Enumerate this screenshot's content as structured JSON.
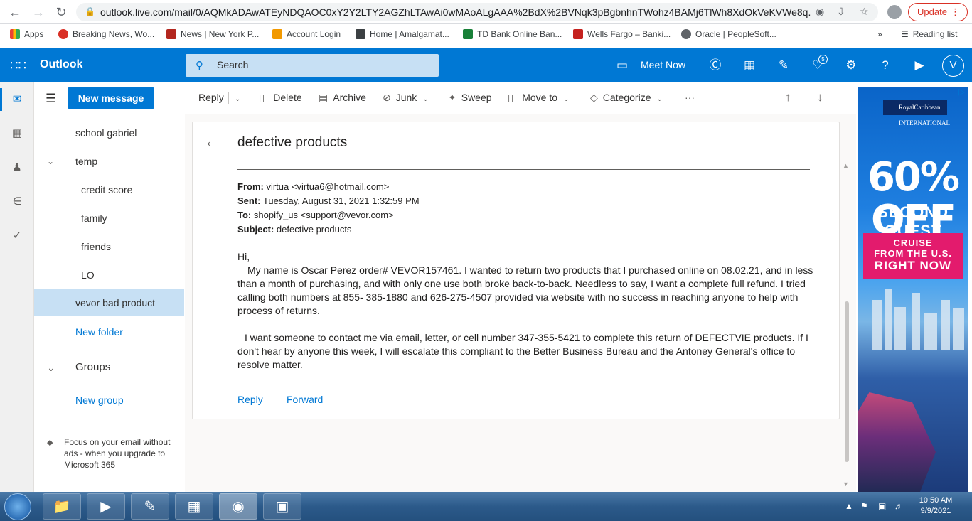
{
  "browser": {
    "url": "outlook.live.com/mail/0/AQMkADAwATEyNDQAOC0xY2Y2LTY2AGZhLTAwAi0wMAoALgAAA%2BdX%2BVNqk3pBgbnhnTWohz4BAMj6TlWh8XdOkVeKVWe8q...",
    "update_label": "Update",
    "bookmarks": [
      {
        "label": "Apps",
        "color": "#ea4335"
      },
      {
        "label": "Breaking News, Wo...",
        "color": "#d93025"
      },
      {
        "label": "News | New York P...",
        "color": "#b3261e"
      },
      {
        "label": "Account Login",
        "color": "#f29900"
      },
      {
        "label": "Home | Amalgamat...",
        "color": "#3c4043"
      },
      {
        "label": "TD Bank Online Ban...",
        "color": "#188038"
      },
      {
        "label": "Wells Fargo – Banki...",
        "color": "#c5221f"
      },
      {
        "label": "Oracle | PeopleSoft...",
        "color": "#5f6368"
      }
    ],
    "reading_list_label": "Reading list"
  },
  "header": {
    "brand": "Outlook",
    "search_placeholder": "Search",
    "meet_now": "Meet Now",
    "notification_count": "5",
    "avatar_initial": "V"
  },
  "nav": {
    "new_message": "New message",
    "folders": [
      {
        "label": "school gabriel",
        "indent": 1
      },
      {
        "label": "temp",
        "indent": 1,
        "expandable": true
      },
      {
        "label": "credit score",
        "indent": 2
      },
      {
        "label": "family",
        "indent": 2
      },
      {
        "label": "friends",
        "indent": 2
      },
      {
        "label": "LO",
        "indent": 2
      },
      {
        "label": "vevor bad product",
        "indent": 1,
        "selected": true
      },
      {
        "label": "New folder",
        "indent": 1,
        "link": true
      }
    ],
    "groups_label": "Groups",
    "new_group": "New group",
    "upsell": "Focus on your email without ads - when you upgrade to Microsoft 365"
  },
  "toolbar": {
    "reply": "Reply",
    "delete": "Delete",
    "archive": "Archive",
    "junk": "Junk",
    "sweep": "Sweep",
    "move_to": "Move to",
    "categorize": "Categorize",
    "more": "···"
  },
  "message": {
    "subject": "defective products",
    "from_label": "From:",
    "from_value": "virtua <virtua6@hotmail.com>",
    "sent_label": "Sent:",
    "sent_value": "Tuesday, August 31, 2021 1:32:59 PM",
    "to_label": "To:",
    "to_value": "shopify_us <support@vevor.com>",
    "subject_label": "Subject:",
    "subject_value": "defective products",
    "greeting": "Hi,",
    "paragraph1": "My name is Oscar Perez order# VEVOR157461. I wanted to return two products that I purchased online on 08.02.21, and in less than a month of purchasing, and with only one use both broke back-to-back. Needless to say, I want a complete full refund. I tried calling both numbers at 855- 385-1880 and 626-275-4507 provided via website with no success in reaching anyone to help with process of returns.",
    "paragraph2": "I want someone to contact me via email, letter, or cell number 347-355-5421 to complete this return of DEFECTVIE products. If I don't hear by anyone this week, I will escalate this compliant to the Better Business Bureau and the Antoney General's office to resolve matter.",
    "reply": "Reply",
    "forward": "Forward"
  },
  "ad": {
    "brand": "RoyalCaribbean INTERNATIONAL",
    "headline": "60% OFF",
    "sub": "SECOND GUEST",
    "cta_line1": "CRUISE",
    "cta_line2": "FROM THE U.S.",
    "cta_line3": "RIGHT NOW"
  },
  "taskbar": {
    "time": "10:50 AM",
    "date": "9/9/2021"
  }
}
